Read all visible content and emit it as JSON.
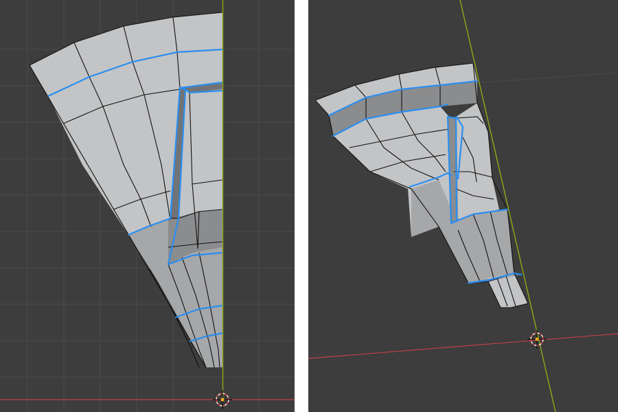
{
  "viewports": [
    {
      "name": "front-view",
      "label": ""
    },
    {
      "name": "perspective-view",
      "label": ""
    }
  ],
  "colors": {
    "background": "#3d3d3d",
    "grid": "#4a4a4a",
    "mesh_face": "#c3c4c6",
    "mesh_edge": "#111111",
    "selected_edge": "#2a8ef0",
    "axis_y": "#8aa31a",
    "axis_x": "#c0404a",
    "origin_cursor": "#e04040"
  },
  "icons": [
    "3d-cursor-icon"
  ]
}
